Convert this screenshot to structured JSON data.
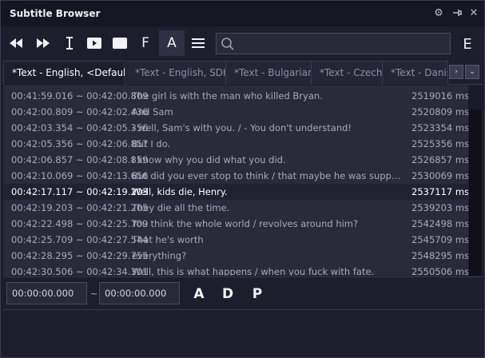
{
  "window": {
    "title": "Subtitle Browser"
  },
  "titlebar_icons": [
    {
      "name": "gear-icon",
      "glyph": "⚙"
    },
    {
      "name": "pin-icon",
      "glyph": "⊸"
    },
    {
      "name": "close-icon",
      "glyph": "✕"
    }
  ],
  "toolbar": {
    "tools": [
      {
        "name": "rewind-button",
        "icon": "rewind-icon"
      },
      {
        "name": "fast-forward-button",
        "icon": "fast-forward-icon"
      },
      {
        "name": "text-cursor-button",
        "icon": "text-cursor-icon"
      },
      {
        "name": "play-video-button",
        "icon": "video-play-icon"
      },
      {
        "name": "subtitle-box-button",
        "icon": "subtitle-box-icon"
      },
      {
        "name": "font-button",
        "label": "F"
      },
      {
        "name": "font-a-button",
        "label": "A",
        "active": true
      },
      {
        "name": "menu-button",
        "icon": "hamburger-icon"
      }
    ],
    "search": {
      "value": "",
      "placeholder": ""
    },
    "e_label": "E"
  },
  "tabs": [
    {
      "label": "*Text - English, <Default>",
      "active": true
    },
    {
      "label": "*Text - English, SDH"
    },
    {
      "label": "*Text - Bulgarian"
    },
    {
      "label": "*Text - Czech"
    },
    {
      "label": "*Text - Danish"
    }
  ],
  "tab_arrows": {
    "right": "›",
    "down": "⌄"
  },
  "subtitles": [
    {
      "time": "00:41:59.016 ~ 00:42:00.809",
      "text": "The girl is with the man who killed Bryan.",
      "ms": "2519016 ms"
    },
    {
      "time": "00:42:00.809 ~ 00:42:02.436",
      "text": "And Sam",
      "ms": "2520809 ms"
    },
    {
      "time": "00:42:03.354 ~ 00:42:05.356",
      "text": "- well, Sam's with you. / - You don't understand!",
      "ms": "2523354 ms"
    },
    {
      "time": "00:42:05.356 ~ 00:42:06.857",
      "text": "But I do.",
      "ms": "2525356 ms"
    },
    {
      "time": "00:42:06.857 ~ 00:42:08.859",
      "text": "I know why you did what you did.",
      "ms": "2526857 ms"
    },
    {
      "time": "00:42:10.069 ~ 00:42:13.656",
      "text": "But did you ever stop to think / that maybe he was supposed to die?",
      "ms": "2530069 ms"
    },
    {
      "time": "00:42:17.117 ~ 00:42:19.203",
      "text": "Well, kids die, Henry.",
      "ms": "2537117 ms",
      "selected": true
    },
    {
      "time": "00:42:19.203 ~ 00:42:21.205",
      "text": "They die all the time.",
      "ms": "2539203 ms"
    },
    {
      "time": "00:42:22.498 ~ 00:42:25.709",
      "text": "You think the whole world / revolves around him?",
      "ms": "2542498 ms"
    },
    {
      "time": "00:42:25.709 ~ 00:42:27.544",
      "text": "That he's worth",
      "ms": "2545709 ms"
    },
    {
      "time": "00:42:28.295 ~ 00:42:29.755",
      "text": "everything?",
      "ms": "2548295 ms"
    },
    {
      "time": "00:42:30.506 ~ 00:42:34.301",
      "text": "Well, this is what happens / when you fuck with fate.",
      "ms": "2550506 ms"
    }
  ],
  "bottom": {
    "start_time": "00:00:00.000",
    "tilde": "~",
    "end_time": "00:00:00.000",
    "buttons": [
      {
        "name": "add-button",
        "label": "A"
      },
      {
        "name": "delete-button",
        "label": "D"
      },
      {
        "name": "p-button",
        "label": "P"
      }
    ]
  }
}
